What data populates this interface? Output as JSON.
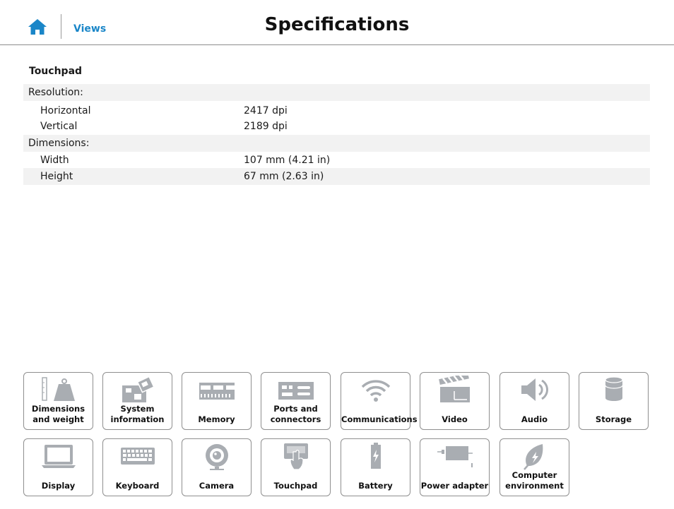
{
  "header": {
    "title": "Specifications",
    "views_label": "Views",
    "home_icon": "home-icon"
  },
  "section": {
    "title": "Touchpad",
    "rows": [
      {
        "label": "Resolution:",
        "value": "",
        "indent": false,
        "shade": true
      },
      {
        "label": "Horizontal",
        "value": "2417 dpi",
        "indent": true,
        "shade": false
      },
      {
        "label": "Vertical",
        "value": "2189 dpi",
        "indent": true,
        "shade": false
      },
      {
        "label": "Dimensions:",
        "value": "",
        "indent": false,
        "shade": true
      },
      {
        "label": "Width",
        "value": "107 mm (4.21 in)",
        "indent": true,
        "shade": false
      },
      {
        "label": "Height",
        "value": "67 mm (2.63 in)",
        "indent": true,
        "shade": true
      }
    ]
  },
  "nav_tiles": [
    {
      "label": "Dimensions and weight",
      "icon": "weight-icon"
    },
    {
      "label": "System information",
      "icon": "motherboard-icon"
    },
    {
      "label": "Memory",
      "icon": "memory-icon"
    },
    {
      "label": "Ports and connectors",
      "icon": "ports-icon"
    },
    {
      "label": "Communications",
      "icon": "wifi-icon"
    },
    {
      "label": "Video",
      "icon": "clapperboard-icon"
    },
    {
      "label": "Audio",
      "icon": "speaker-icon"
    },
    {
      "label": "Storage",
      "icon": "storage-icon"
    },
    {
      "label": "Display",
      "icon": "laptop-icon"
    },
    {
      "label": "Keyboard",
      "icon": "keyboard-icon"
    },
    {
      "label": "Camera",
      "icon": "webcam-icon"
    },
    {
      "label": "Touchpad",
      "icon": "touchpad-icon"
    },
    {
      "label": "Battery",
      "icon": "battery-icon"
    },
    {
      "label": "Power adapter",
      "icon": "power-adapter-icon"
    },
    {
      "label": "Computer environment",
      "icon": "leaf-icon"
    }
  ],
  "colors": {
    "link": "#1a86c8",
    "icon_gray": "#a9adb2",
    "row_shade": "#f2f2f2"
  }
}
